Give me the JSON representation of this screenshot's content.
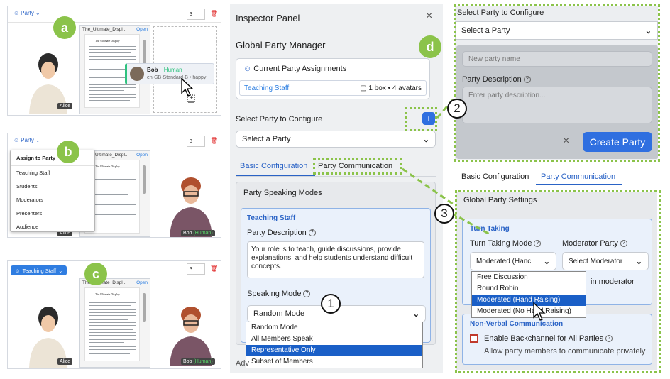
{
  "panel_a": {
    "badge": "a",
    "toolbar_label": "Party",
    "count": "3",
    "doc_title": "The_Ultimate_Displ...",
    "doc_open": "Open",
    "avatar_left_name": "Alice",
    "drag_card": {
      "name": "Bob",
      "role": "Human",
      "voice": "en-GB-Standard-B",
      "mood": "happy"
    }
  },
  "panel_b": {
    "badge": "b",
    "toolbar_label": "Party",
    "count": "3",
    "doc_title": "Ultimate_Displ...",
    "doc_open": "Open",
    "menu_header": "Assign to Party",
    "menu_items": [
      "Teaching Staff",
      "Students",
      "Moderators",
      "Presenters",
      "Audience"
    ],
    "avatar_left_name": "Alice",
    "avatar_right_name": "Bob",
    "avatar_right_tag": "(Human)"
  },
  "panel_c": {
    "badge": "c",
    "toolbar_label": "Teaching Staff",
    "count": "3",
    "doc_title": "The_Ultimate_Displ...",
    "doc_open": "Open",
    "avatar_left_name": "Alice",
    "avatar_right_name": "Bob",
    "avatar_right_tag": "(Human)"
  },
  "doc": {
    "page_heading": "The Ultimate Display"
  },
  "inspector": {
    "title": "Inspector Panel",
    "close": "×",
    "section": "Global Party Manager",
    "badge_d": "d",
    "assignments_title": "Current Party Assignments",
    "assignment_party": "Teaching Staff",
    "assignment_info": "1 box • 4 avatars",
    "select_label": "Select Party to Configure",
    "select_value": "Select a Party",
    "tab_basic": "Basic Configuration",
    "tab_comm": "Party Communication",
    "speaking_modes_title": "Party Speaking Modes",
    "party_name": "Teaching Staff",
    "party_desc_label": "Party Description",
    "party_desc_text": "Your role is to teach, guide discussions, provide explanations, and help students understand difficult concepts.",
    "speaking_mode_label": "Speaking Mode",
    "speaking_mode_value": "Random Mode",
    "speaking_options": [
      "Random Mode",
      "All Members Speak",
      "Representative Only",
      "Subset of Members"
    ],
    "speaking_selected_index": 2,
    "adv_label": "Adv",
    "num1": "1"
  },
  "right_top": {
    "select_label": "Select Party to Configure",
    "select_value": "Select a Party",
    "name_placeholder": "New party name",
    "desc_label": "Party Description",
    "desc_placeholder": "Enter party description...",
    "cancel": "×",
    "create": "Create Party",
    "num2": "2"
  },
  "right_bottom": {
    "tab_basic": "Basic Configuration",
    "tab_comm": "Party Communication",
    "global_title": "Global Party Settings",
    "turn_title": "Turn Taking",
    "turn_mode_label": "Turn Taking Mode",
    "turn_mode_value": "Moderated (Hanc",
    "mod_party_label": "Moderator Party",
    "mod_party_value": "Select Moderator",
    "turn_options": [
      "Free Discussion",
      "Round Robin",
      "Moderated (Hand Raising)",
      "Moderated (No Hand Raising)"
    ],
    "turn_selected_index": 2,
    "hidden_text": "in moderator",
    "nonverbal_title": "Non-Verbal Communication",
    "backchannel_label": "Enable Backchannel for All Parties",
    "backchannel_desc": "Allow party members to communicate privately",
    "num3": "3"
  },
  "colors": {
    "green": "#8bc34a",
    "blue": "#2f6fe0",
    "selected": "#1a5fc7"
  }
}
